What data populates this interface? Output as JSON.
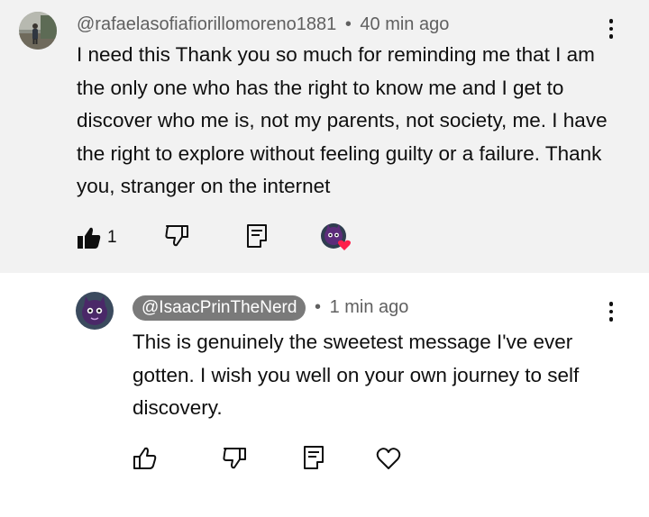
{
  "comment": {
    "author": "@rafaelasofiafiorillomoreno1881",
    "separator": "•",
    "time": "40 min ago",
    "text": "I need this Thank you so much for reminding me that I am the only one who has the right to know me and I get to discover who me is, not my parents, not society, me. I have the right to explore without feeling guilty or a failure. Thank you, stranger on the internet",
    "like_count": "1",
    "colors": {
      "background": "#f2f2f2",
      "heart": "#ff1f4b"
    },
    "icons": [
      "like-filled-icon",
      "dislike-icon",
      "reply-icon",
      "creator-heart-icon",
      "more-options-icon"
    ]
  },
  "reply": {
    "author": "@IsaacPrinTheNerd",
    "separator": "•",
    "time": "1 min ago",
    "text": "This is genuinely the sweetest message I've ever gotten. I wish you well on your own journey to self discovery.",
    "colors": {
      "background": "#ffffff",
      "author_pill": "#7a7a7a"
    },
    "icons": [
      "like-icon",
      "dislike-icon",
      "reply-icon",
      "heart-icon",
      "more-options-icon"
    ]
  }
}
